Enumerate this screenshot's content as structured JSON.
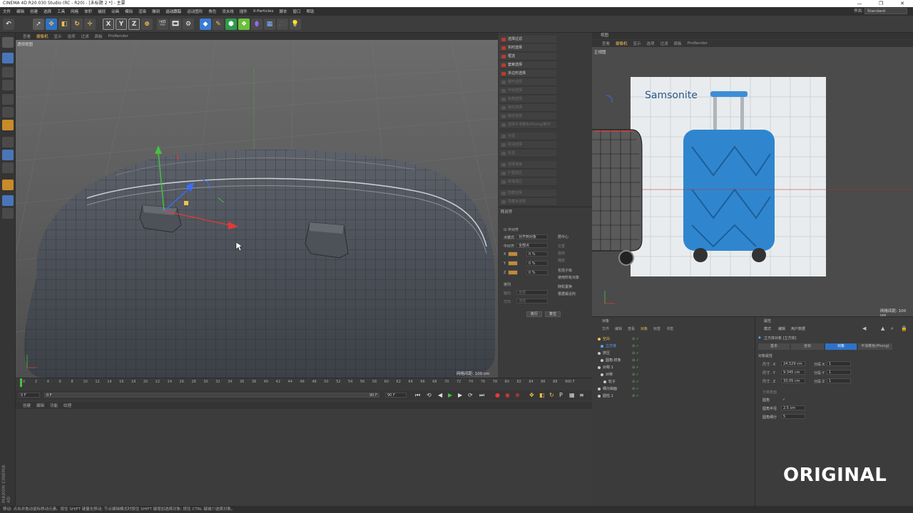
{
  "window": {
    "title": "CINEMA 4D R20.030 Studio (RC - R20) - [未标题 2 *] - 主要",
    "minimize": "—",
    "maximize": "❐",
    "close": "✕"
  },
  "menu": {
    "items": [
      "文件",
      "编辑",
      "创建",
      "选择",
      "工具",
      "网格",
      "体积",
      "捕捉",
      "动画",
      "模拟",
      "渲染",
      "雕刻",
      "运动跟踪",
      "运动图形",
      "角色",
      "流水线",
      "插件",
      "X-Particles",
      "脚本",
      "窗口",
      "帮助"
    ],
    "layout_label": "界面:",
    "layout_value": "Standard"
  },
  "toolbar": {
    "x_label": "X",
    "y_label": "Y",
    "z_label": "Z"
  },
  "viewport": {
    "menu": [
      "查看",
      "摄像机",
      "显示",
      "选项",
      "过滤",
      "面板",
      "ProRender"
    ],
    "active_menu": 1,
    "label": "透视视图",
    "scale": "网格间距: 100 cm"
  },
  "commands": {
    "active": [
      "选择过滤",
      "实时选择",
      "框选",
      "套索选择",
      "多边形选择"
    ],
    "dim": [
      "循环选择",
      "环状选择",
      "轮廓选择",
      "填充选择",
      "路径选择",
      "选择平滑着色(Phong)断开",
      "全选",
      "取消选择",
      "反选",
      "选择连接",
      "扩展选区",
      "收缩选区",
      "隐藏选择",
      "隐藏未选择",
      "全部显示",
      "反转可见",
      "设置选集",
      "设置顶点权重"
    ]
  },
  "align": {
    "title": "阵对齐",
    "align_check": "中对齐",
    "mode_label": "点模式",
    "mode_value": "对齐到对象",
    "center_label": "中对齐",
    "center_value": "全部点",
    "x": "X",
    "y": "Y",
    "z": "Z",
    "x_val": "0 %",
    "y_val": "0 %",
    "z_val": "0 %",
    "opt_center": "居中心",
    "opt_pos": "位置",
    "opt_rot": "旋转",
    "opt_scale": "缩放",
    "opt_include": "包括子级",
    "opt_all": "使用所有对象",
    "sort": "排列",
    "opt_random": "随机置换",
    "opt_snap": "根据最近的",
    "axis_label": "轴向",
    "axis_value": "全部",
    "dir_label": "方向",
    "dir_value": "法线",
    "apply": "执行",
    "reset": "复位"
  },
  "rightview": {
    "title": "视图",
    "menu": [
      "查看",
      "摄像机",
      "显示",
      "选项",
      "过滤",
      "面板",
      "ProRender"
    ],
    "active_menu": 1,
    "label": "正视图",
    "scale": "网格间距: 100 cm",
    "brand": "Samsonite"
  },
  "objects": {
    "panel_title": "对象",
    "menu": [
      "文件",
      "编辑",
      "查看",
      "对象",
      "标签",
      "书签"
    ],
    "active_menu": 3,
    "rows": [
      {
        "name": "空白",
        "indent": 1,
        "color": "#f2c14e"
      },
      {
        "name": "立方体",
        "indent": 2,
        "color": "#55a8ff"
      },
      {
        "name": "挤压",
        "indent": 1,
        "color": "#c8c8c8"
      },
      {
        "name": "圆角·样条",
        "indent": 2,
        "color": "#c8c8c8"
      },
      {
        "name": "对称.1",
        "indent": 1,
        "color": "#c8c8c8"
      },
      {
        "name": "对称",
        "indent": 2,
        "color": "#c8c8c8"
      },
      {
        "name": "轮子",
        "indent": 3,
        "color": "#c8c8c8"
      },
      {
        "name": "细分曲面",
        "indent": 1,
        "color": "#c8c8c8"
      },
      {
        "name": "圆柱.1",
        "indent": 1,
        "color": "#c8c8c8"
      }
    ]
  },
  "attributes": {
    "panel_title": "属性",
    "menu": [
      "模式",
      "编辑",
      "用户数据"
    ],
    "object_title": "立方体对象 [立方体]",
    "tabs": [
      "基本",
      "坐标",
      "对象",
      "平滑着色(Phong)"
    ],
    "active_tab": 2,
    "section": "对象属性",
    "size_x_label": "尺寸 . X",
    "size_y_label": "尺寸 . Y",
    "size_z_label": "尺寸 . Z",
    "size_x": "24.529 cm",
    "size_y": "9.345 cm",
    "size_z": "33.05 cm",
    "seg_x_label": "分段 X",
    "seg_y_label": "分段 Y",
    "seg_z_label": "分段 Z",
    "seg_x": "1",
    "seg_y": "1",
    "seg_z": "1",
    "separate": "分离表面",
    "fillet": "圆角",
    "fillet_check": "✓",
    "fillet_radius_label": "圆角半径",
    "fillet_radius": "2.5 cm",
    "fillet_sub_label": "圆角细分",
    "fillet_sub": "5"
  },
  "timeline": {
    "ticks": [
      "0",
      "2",
      "4",
      "6",
      "8",
      "10",
      "12",
      "14",
      "16",
      "18",
      "20",
      "22",
      "24",
      "26",
      "28",
      "30",
      "32",
      "34",
      "36",
      "38",
      "40",
      "42",
      "44",
      "46",
      "48",
      "50",
      "52",
      "54",
      "56",
      "58",
      "60",
      "62",
      "64",
      "66",
      "68",
      "70",
      "72",
      "74",
      "76",
      "78",
      "80",
      "82",
      "84",
      "86",
      "88",
      "90"
    ],
    "end_frame": "0 F",
    "start_field": "0 F",
    "slider_start": "0 F",
    "slider_end": "90 F",
    "end_field": "90 F"
  },
  "material_menu": [
    "创建",
    "编辑",
    "功能",
    "纹理"
  ],
  "status": "移动: 点击并拖动鼠标移动元素。按住 SHIFT 键量化移动; 节点编辑模式时按住 SHIFT 键增加选择对象; 按住 CTRL 键减少选择对象。",
  "watermark": "ORIGINAL",
  "maxon": "MAXON CINEMA 4D",
  "colors": {
    "accent": "#f2c14e",
    "selection_blue": "#2e72c7",
    "axis_x": "#e53935",
    "axis_y": "#43c343",
    "axis_z": "#3a6cff"
  }
}
